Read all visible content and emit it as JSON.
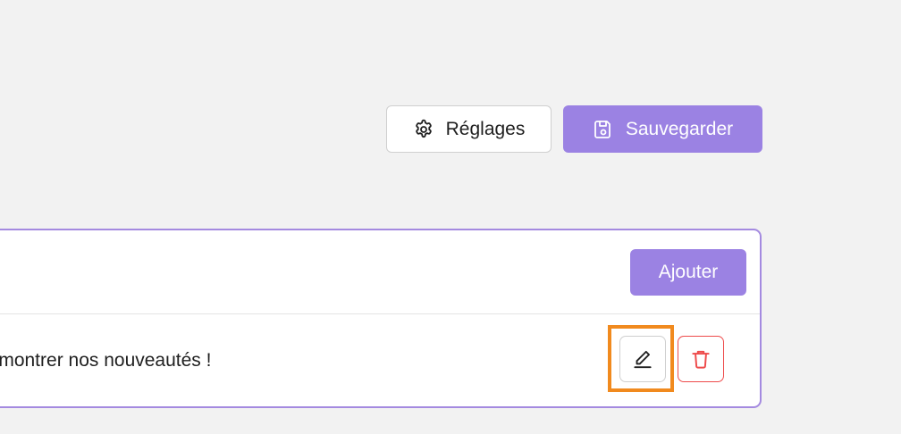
{
  "toolbar": {
    "settings_label": "Réglages",
    "settings_icon": "gear-icon",
    "save_label": "Sauvegarder",
    "save_icon": "floppy-disk-icon"
  },
  "panel": {
    "add_label": "Ajouter",
    "item": {
      "text": "s montrer nos nouveautés !",
      "edit_icon": "pencil-icon",
      "delete_icon": "trash-icon"
    }
  },
  "colors": {
    "background": "#f2f2f2",
    "accent": "#9b82e3",
    "panel_border": "#a48ae0",
    "danger": "#ee4b4b",
    "focus_highlight": "#f18a1e"
  }
}
